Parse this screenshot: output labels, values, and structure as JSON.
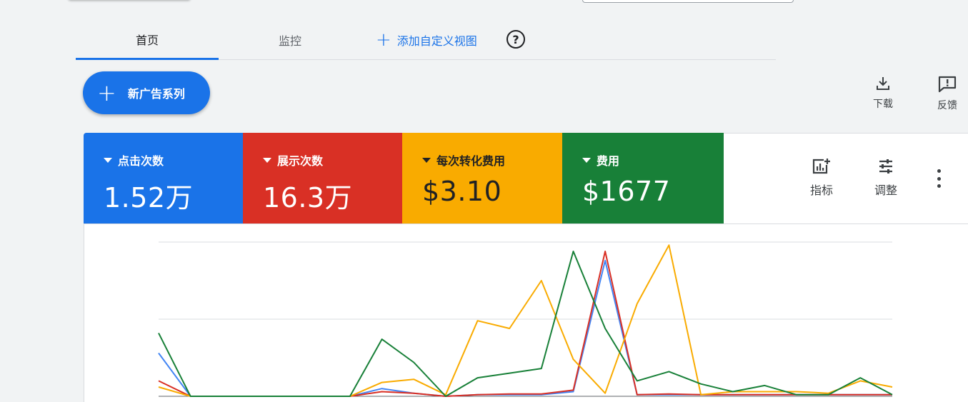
{
  "tabs": {
    "home": "首页",
    "monitor": "监控",
    "add_view": "添加自定义视图",
    "add_icon": "plus-icon",
    "help_icon": "help-circle-icon"
  },
  "toolbar": {
    "new_campaign": "新广告系列",
    "download": "下载",
    "feedback": "反馈"
  },
  "metrics": [
    {
      "label": "点击次数",
      "value": "1.52万",
      "color": "#1a73e8"
    },
    {
      "label": "展示次数",
      "value": "16.3万",
      "color": "#d93025"
    },
    {
      "label": "每次转化费用",
      "value": "$3.10",
      "color": "#f9ab00"
    },
    {
      "label": "费用",
      "value": "$1677",
      "color": "#188038"
    }
  ],
  "card_tools": {
    "metrics": "指标",
    "adjust": "调整"
  },
  "chart_data": {
    "type": "line",
    "grid": true,
    "ylim": [
      0,
      1
    ],
    "x": [
      0,
      1,
      2,
      3,
      4,
      5,
      6,
      7,
      8,
      9,
      10,
      11,
      12,
      13,
      14,
      15,
      16,
      17,
      18,
      19,
      20,
      21,
      22,
      23
    ],
    "series": [
      {
        "color": "#4285f4",
        "values": [
          0.28,
          0,
          0,
          0,
          0,
          0,
          0,
          0.05,
          0.02,
          0,
          0.01,
          0.01,
          0.01,
          0.03,
          0.88,
          0.01,
          0.01,
          0.01,
          0.01,
          0.01,
          0.01,
          0.01,
          0.01,
          0.01
        ]
      },
      {
        "color": "#d93025",
        "values": [
          0.1,
          0,
          0,
          0,
          0,
          0,
          0,
          0.03,
          0.02,
          0,
          0.01,
          0.015,
          0.015,
          0.04,
          0.94,
          0.01,
          0.015,
          0.01,
          0.01,
          0.01,
          0.01,
          0.01,
          0.01,
          0.01
        ]
      },
      {
        "color": "#f9ab00",
        "values": [
          0.06,
          0,
          0,
          0,
          0,
          0,
          0,
          0.09,
          0.11,
          0.01,
          0.49,
          0.44,
          0.75,
          0.24,
          0.02,
          0.6,
          0.98,
          0.01,
          0.03,
          0.03,
          0.03,
          0.02,
          0.1,
          0.06
        ]
      },
      {
        "color": "#188038",
        "values": [
          0.41,
          0,
          0,
          0,
          0,
          0,
          0,
          0.37,
          0.22,
          0,
          0.12,
          0.15,
          0.18,
          0.94,
          0.44,
          0.1,
          0.16,
          0.08,
          0.03,
          0.07,
          0.01,
          0.01,
          0.12,
          0.01
        ]
      }
    ]
  }
}
